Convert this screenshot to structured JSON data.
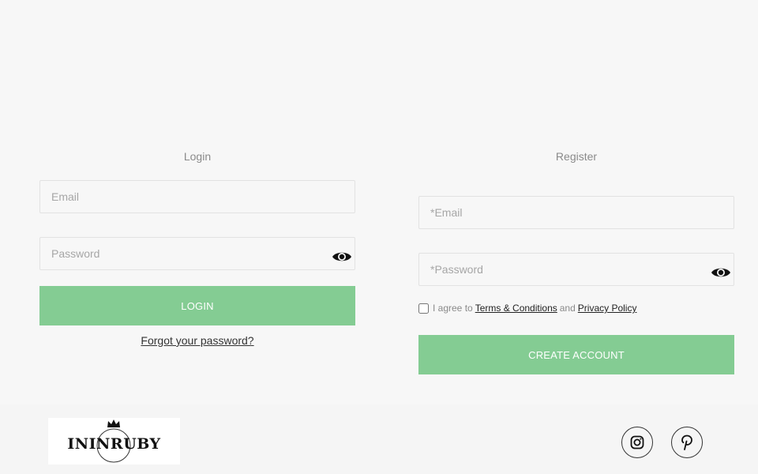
{
  "login": {
    "title": "Login",
    "email_placeholder": "Email",
    "password_placeholder": "Password",
    "button_label": "LOGIN",
    "forgot_label": "Forgot your password?"
  },
  "register": {
    "title": "Register",
    "email_placeholder": "*Email",
    "password_placeholder": "*Password",
    "agree_prefix": "I agree to",
    "terms_label": "Terms & Conditions",
    "and_label": "and",
    "privacy_label": "Privacy Policy",
    "button_label": "CREATE ACCOUNT"
  },
  "footer": {
    "logo_text": "ININRUBY",
    "social": [
      {
        "icon": "instagram-icon"
      },
      {
        "icon": "pinterest-icon"
      }
    ]
  },
  "colors": {
    "background": "#f7f7f7",
    "button": "#84cc93",
    "button_text": "#ffffff",
    "border": "#e2e2e2"
  }
}
